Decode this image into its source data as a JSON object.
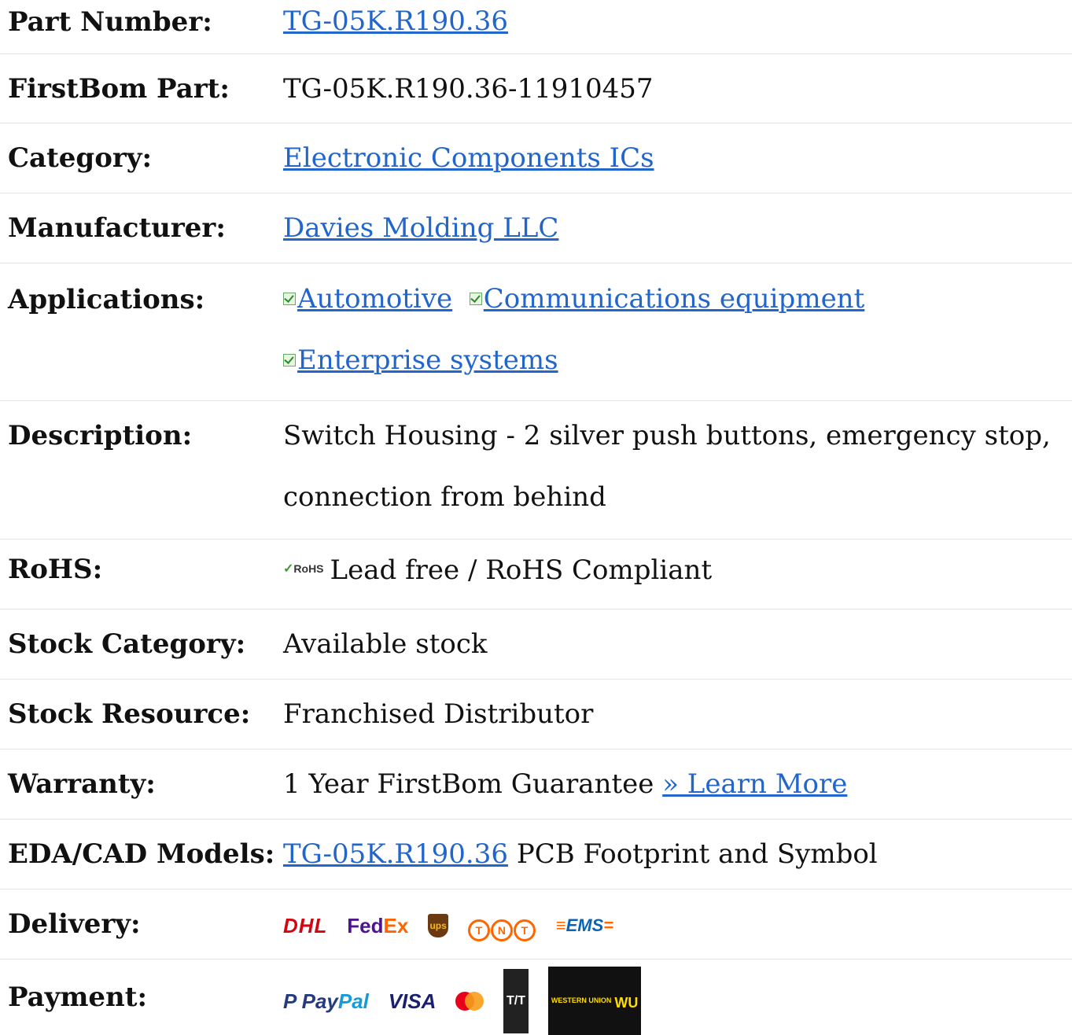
{
  "rows": {
    "part_number": {
      "label": "Part Number:",
      "value": "TG-05K.R190.36"
    },
    "firstbom_part": {
      "label": "FirstBom Part:",
      "value": "TG-05K.R190.36-11910457"
    },
    "category": {
      "label": "Category:",
      "value": "Electronic Components ICs"
    },
    "manufacturer": {
      "label": "Manufacturer:",
      "value": "Davies Molding LLC"
    },
    "applications": {
      "label": "Applications:",
      "items": [
        "Automotive",
        "Communications equipment",
        "Enterprise systems"
      ]
    },
    "description": {
      "label": "Description:",
      "value": "Switch Housing - 2 silver push buttons, emergency stop, connection from behind"
    },
    "rohs": {
      "label": "RoHS:",
      "logo_text": "RoHS",
      "value": "Lead free / RoHS Compliant"
    },
    "stock_category": {
      "label": "Stock Category:",
      "value": "Available stock"
    },
    "stock_resource": {
      "label": "Stock Resource:",
      "value": "Franchised Distributor"
    },
    "warranty": {
      "label": "Warranty:",
      "value": "1 Year FirstBom Guarantee",
      "link": "» Learn More"
    },
    "eda_cad": {
      "label": "EDA/CAD Models:",
      "link": "TG-05K.R190.36",
      "suffix": "PCB Footprint and Symbol"
    },
    "delivery": {
      "label": "Delivery:",
      "carriers": [
        "DHL",
        "FedEx",
        "ups",
        "TNT",
        "EMS"
      ]
    },
    "payment": {
      "label": "Payment:",
      "methods": [
        "PayPal",
        "VISA",
        "MasterCard",
        "T/T",
        "WESTERN UNION",
        "WU"
      ]
    }
  },
  "colors": {
    "link": "#2266cc",
    "divider": "#e3e3e3"
  }
}
